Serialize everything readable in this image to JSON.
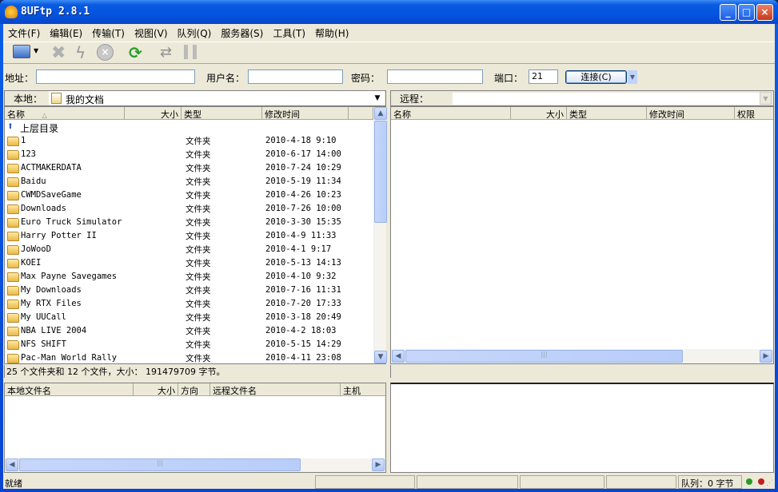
{
  "window": {
    "title": "8UFtp 2.8.1",
    "minimize": "_",
    "maximize": "□",
    "close": "×"
  },
  "menu": [
    "文件(F)",
    "编辑(E)",
    "传输(T)",
    "视图(V)",
    "队列(Q)",
    "服务器(S)",
    "工具(T)",
    "帮助(H)"
  ],
  "toolbar": {
    "icons": [
      "connect-icon",
      "disconnect-icon",
      "quick-connect-icon",
      "stop-icon",
      "refresh-icon",
      "transfer-icon",
      "pause-icon"
    ]
  },
  "connect_bar": {
    "address_label": "地址：",
    "address_value": "",
    "user_label": "用户名：",
    "user_value": "",
    "password_label": "密码：",
    "password_value": "",
    "port_label": "端口：",
    "port_value": "21",
    "connect_button": "连接(C)"
  },
  "local": {
    "label": "本地：",
    "path": "我的文档",
    "columns": [
      "名称",
      "大小",
      "类型",
      "修改时间"
    ],
    "parent": "上层目录",
    "rows": [
      {
        "name": "1",
        "type": "文件夹",
        "modified": "2010-4-18 9:10"
      },
      {
        "name": "123",
        "type": "文件夹",
        "modified": "2010-6-17 14:00"
      },
      {
        "name": "ACTMAKERDATA",
        "type": "文件夹",
        "modified": "2010-7-24 10:29"
      },
      {
        "name": "Baidu",
        "type": "文件夹",
        "modified": "2010-5-19 11:34"
      },
      {
        "name": "CWMDSaveGame",
        "type": "文件夹",
        "modified": "2010-4-26 10:23"
      },
      {
        "name": "Downloads",
        "type": "文件夹",
        "modified": "2010-7-26 10:00"
      },
      {
        "name": "Euro Truck Simulator",
        "type": "文件夹",
        "modified": "2010-3-30 15:35"
      },
      {
        "name": "Harry Potter II",
        "type": "文件夹",
        "modified": "2010-4-9 11:33"
      },
      {
        "name": "JoWooD",
        "type": "文件夹",
        "modified": "2010-4-1 9:17"
      },
      {
        "name": "KOEI",
        "type": "文件夹",
        "modified": "2010-5-13 14:13"
      },
      {
        "name": "Max Payne Savegames",
        "type": "文件夹",
        "modified": "2010-4-10 9:32"
      },
      {
        "name": "My Downloads",
        "type": "文件夹",
        "modified": "2010-7-16 11:31"
      },
      {
        "name": "My RTX Files",
        "type": "文件夹",
        "modified": "2010-7-20 17:33"
      },
      {
        "name": "My UUCall",
        "type": "文件夹",
        "modified": "2010-3-18 20:49"
      },
      {
        "name": "NBA LIVE 2004",
        "type": "文件夹",
        "modified": "2010-4-2 18:03"
      },
      {
        "name": "NFS SHIFT",
        "type": "文件夹",
        "modified": "2010-5-15 14:29"
      },
      {
        "name": "Pac-Man World Rally",
        "type": "文件夹",
        "modified": "2010-4-11 23:08"
      }
    ],
    "status": "25 个文件夹和 12 个文件，大小： 191479709 字节。"
  },
  "remote": {
    "label": "远程：",
    "path": "",
    "columns": [
      "名称",
      "大小",
      "类型",
      "修改时间",
      "权限"
    ]
  },
  "queue": {
    "columns": [
      "本地文件名",
      "大小",
      "方向",
      "远程文件名",
      "主机"
    ]
  },
  "statusbar": {
    "text": "就绪",
    "queue": "队列：0 字节",
    "colors": {
      "green": "#2a9a2a",
      "red": "#c02020"
    }
  }
}
